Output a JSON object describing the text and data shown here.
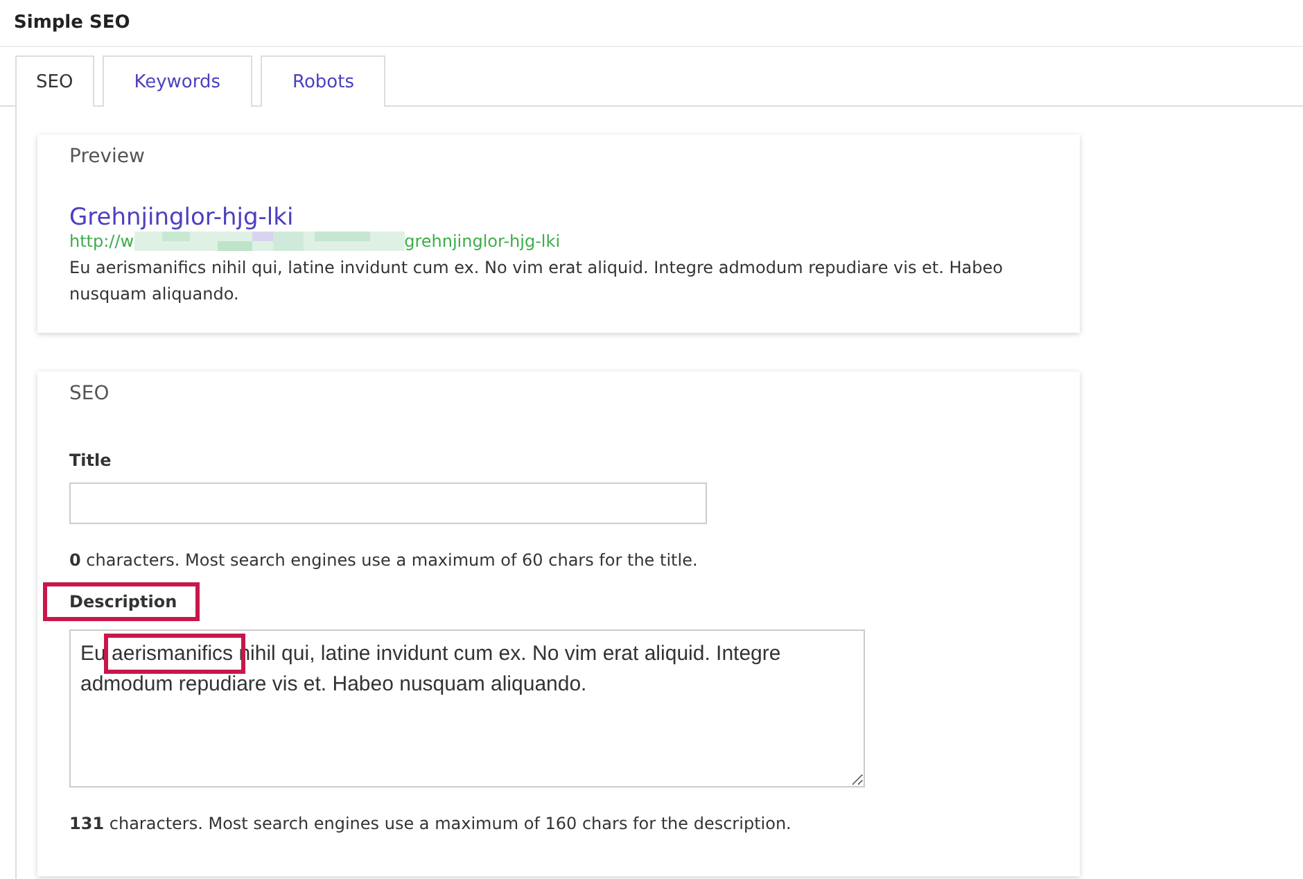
{
  "page": {
    "title": "Simple SEO"
  },
  "tabs": [
    {
      "label": "SEO",
      "selected": true
    },
    {
      "label": "Keywords",
      "selected": false
    },
    {
      "label": "Robots",
      "selected": false
    }
  ],
  "preview": {
    "heading": "Preview",
    "link_title": "Grehnjinglor-hjg-lki",
    "url_start": "http://w",
    "url_redacted": true,
    "url_end": "grehnjinglor-hjg-lki",
    "snippet": "Eu aerismanifics nihil qui, latine invidunt cum ex. No vim erat aliquid. Integre admodum repudiare vis et. Habeo nusquam aliquando."
  },
  "seo": {
    "heading": "SEO",
    "title": {
      "label": "Title",
      "hint": "**0** characters. Most search engines use a maximum of 60 chars for the title."
    },
    "description": {
      "label": "Description",
      "label_highlighted": true,
      "value": "Eu aerismanifics nihil qui, latine invidunt cum ex. No vim erat aliquid. Integre admodum repudiare vis et. Habeo nusquam aliquando.",
      "word_highlighted": true,
      "hint": "**131** characters. Most search engines use a maximum of 160 chars for the description."
    }
  }
}
